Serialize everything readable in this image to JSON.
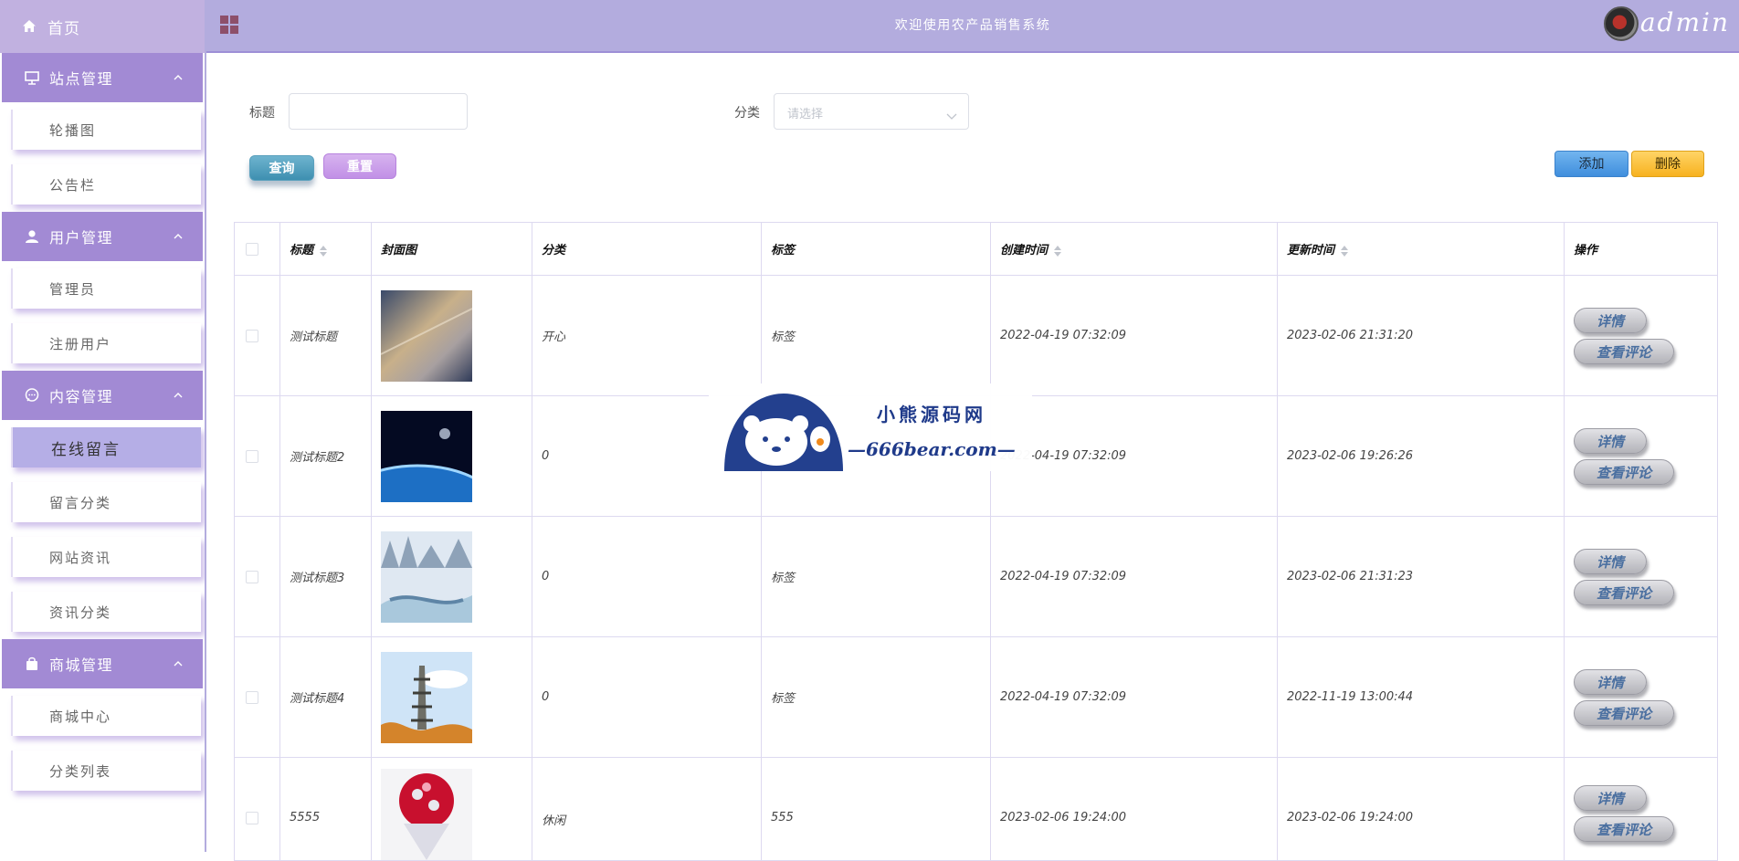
{
  "header": {
    "title": "欢迎使用农产品销售系统",
    "username": "admin"
  },
  "sidebar": {
    "home": "首页",
    "groups": [
      {
        "label": "站点管理",
        "icon": "board-icon",
        "items": [
          "轮播图",
          "公告栏"
        ]
      },
      {
        "label": "用户管理",
        "icon": "user-icon",
        "items": [
          "管理员",
          "注册用户"
        ]
      },
      {
        "label": "内容管理",
        "icon": "message-icon",
        "items": [
          "在线留言",
          "留言分类",
          "网站资讯",
          "资讯分类"
        ]
      },
      {
        "label": "商城管理",
        "icon": "bag-icon",
        "items": [
          "商城中心",
          "分类列表"
        ]
      }
    ],
    "active_item": "在线留言"
  },
  "search": {
    "title_label": "标题",
    "title_value": "",
    "category_label": "分类",
    "category_placeholder": "请选择",
    "query_button": "查询",
    "reset_button": "重置"
  },
  "actions": {
    "add": "添加",
    "delete": "删除"
  },
  "table": {
    "columns": [
      "标题",
      "封面图",
      "分类",
      "标签",
      "创建时间",
      "更新时间",
      "操作"
    ],
    "rows": [
      {
        "title": "测试标题",
        "category": "开心",
        "tag": "标签",
        "created": "2022-04-19 07:32:09",
        "updated": "2023-02-06 21:31:20"
      },
      {
        "title": "测试标题2",
        "category": "0",
        "tag": "",
        "created": "2022-04-19 07:32:09",
        "updated": "2023-02-06 19:26:26"
      },
      {
        "title": "测试标题3",
        "category": "0",
        "tag": "标签",
        "created": "2022-04-19 07:32:09",
        "updated": "2023-02-06 21:31:23"
      },
      {
        "title": "测试标题4",
        "category": "0",
        "tag": "标签",
        "created": "2022-04-19 07:32:09",
        "updated": "2022-11-19 13:00:44"
      },
      {
        "title": "5555",
        "category": "休闲",
        "tag": "555",
        "created": "2023-02-06 19:24:00",
        "updated": "2023-02-06 19:24:00"
      }
    ],
    "op_detail": "详情",
    "op_comment": "查看评论"
  },
  "watermark": {
    "line1": "小熊源码网",
    "line2": "—666bear.com—"
  }
}
